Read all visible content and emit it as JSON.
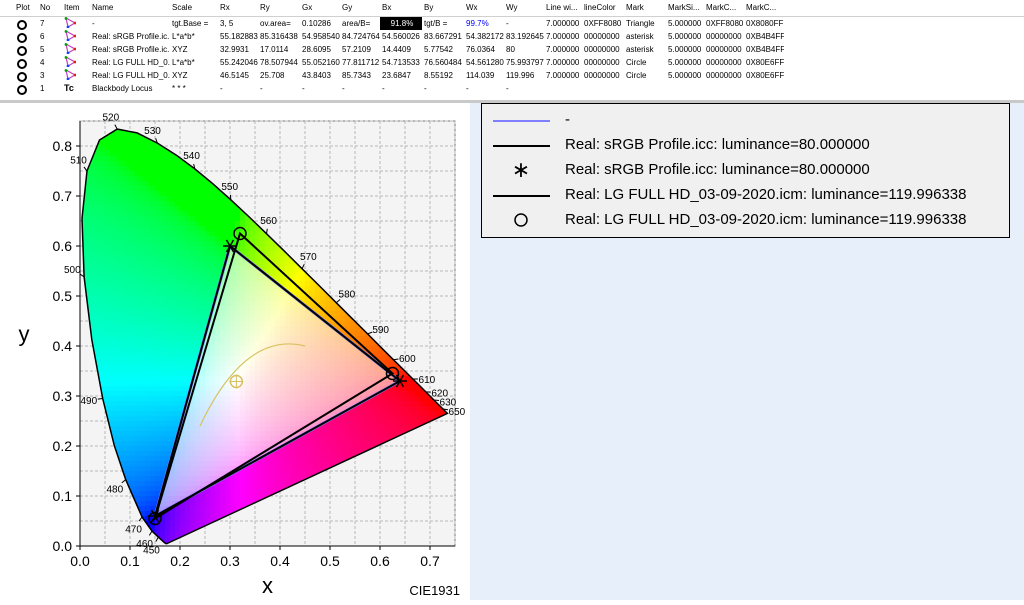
{
  "table": {
    "headers": [
      "Plot",
      "No",
      "Item",
      "Name",
      "Scale",
      "Rx",
      "Ry",
      "Gx",
      "Gy",
      "Bx",
      "By",
      "Wx",
      "Wy",
      "Line wi...",
      "lineColor",
      "Mark",
      "MarkSi...",
      "MarkC...",
      "MarkC..."
    ],
    "rows": [
      {
        "no": "7",
        "icon": "rgb-triangle-icon",
        "name": "-",
        "scale": "tgt.Base =",
        "rx": "3, 5",
        "ry": "ov.area=",
        "gx": "0.10286",
        "gy": "area/B=",
        "bx": "91.8%",
        "by": "tgt/B =",
        "wx": "99.7%",
        "wy": "-",
        "linew": "7.000000",
        "linecolor": "0XFF8080",
        "mark": "Triangle",
        "marksize": "5.000000",
        "markc1": "0XFF8080",
        "markc2": "0X8080FF"
      },
      {
        "no": "6",
        "icon": "rgb-triangle-icon",
        "name": "Real: sRGB Profile.ic...",
        "scale": "L*a*b*",
        "rx": "55.182883",
        "ry": "85.316438",
        "gx": "54.958540",
        "gy": "84.724764",
        "bx": "54.560026",
        "by": "83.667291",
        "wx": "54.382172",
        "wy": "83.192645",
        "linew": "7.000000",
        "linecolor": "00000000",
        "mark": "asterisk",
        "marksize": "5.000000",
        "markc1": "00000000",
        "markc2": "0XB4B4FF"
      },
      {
        "no": "5",
        "icon": "rgb-triangle-icon",
        "name": "Real: sRGB Profile.ic...",
        "scale": "XYZ",
        "rx": "32.9931",
        "ry": "17.0114",
        "gx": "28.6095",
        "gy": "57.2109",
        "bx": "14.4409",
        "by": "5.77542",
        "wx": "76.0364",
        "wy": "80",
        "linew": "7.000000",
        "linecolor": "00000000",
        "mark": "asterisk",
        "marksize": "5.000000",
        "markc1": "00000000",
        "markc2": "0XB4B4FF"
      },
      {
        "no": "4",
        "icon": "rgb-triangle-icon",
        "name": "Real: LG FULL HD_0...",
        "scale": "L*a*b*",
        "rx": "55.242046",
        "ry": "78.507944",
        "gx": "55.052160",
        "gy": "77.811712",
        "bx": "54.713533",
        "by": "76.560484",
        "wx": "54.561280",
        "wy": "75.993797",
        "linew": "7.000000",
        "linecolor": "00000000",
        "mark": "Circle",
        "marksize": "5.000000",
        "markc1": "00000000",
        "markc2": "0X80E6FF"
      },
      {
        "no": "3",
        "icon": "rgb-triangle-icon",
        "name": "Real: LG FULL HD_0...",
        "scale": "XYZ",
        "rx": "46.5145",
        "ry": "25.708",
        "gx": "43.8403",
        "gy": "85.7343",
        "bx": "23.6847",
        "by": "8.55192",
        "wx": "114.039",
        "wy": "119.996",
        "linew": "7.000000",
        "linecolor": "00000000",
        "mark": "Circle",
        "marksize": "5.000000",
        "markc1": "00000000",
        "markc2": "0X80E6FF"
      },
      {
        "no": "1",
        "icon": "tc-icon",
        "name": "Blackbody Locus",
        "scale": "* * *",
        "rx": "-",
        "ry": "-",
        "gx": "-",
        "gy": "-",
        "bx": "-",
        "by": "-",
        "wx": "-",
        "wy": "-",
        "linew": "",
        "linecolor": "",
        "mark": "",
        "marksize": "",
        "markc1": "",
        "markc2": ""
      }
    ]
  },
  "legend": {
    "entries": [
      {
        "text": "-"
      },
      {
        "text": "Real: sRGB Profile.icc: luminance=80.000000"
      },
      {
        "text": "Real: sRGB Profile.icc: luminance=80.000000"
      },
      {
        "text": "Real: LG FULL HD_03-09-2020.icm: luminance=119.996338"
      },
      {
        "text": "Real: LG FULL HD_03-09-2020.icm: luminance=119.996338"
      }
    ],
    "colors": [
      "#8080ff",
      "#000000",
      "#000000",
      "#000000",
      "#000000"
    ],
    "markers": [
      "",
      "",
      "asterisk",
      "",
      "circle"
    ]
  },
  "chart_data": {
    "type": "scatter",
    "title": "",
    "xlabel": "x",
    "ylabel": "y",
    "caption": "CIE1931",
    "xlim": [
      0,
      0.75
    ],
    "ylim": [
      0,
      0.85
    ],
    "x_ticks": [
      "0.0",
      "0.1",
      "0.2",
      "0.3",
      "0.4",
      "0.5",
      "0.6",
      "0.7"
    ],
    "y_ticks": [
      "0.0",
      "0.1",
      "0.2",
      "0.3",
      "0.4",
      "0.5",
      "0.6",
      "0.7",
      "0.8"
    ],
    "grid": true,
    "wavelength_labels": [
      {
        "label": "520",
        "x": 0.0743,
        "y": 0.8338
      },
      {
        "label": "530",
        "x": 0.1547,
        "y": 0.8059
      },
      {
        "label": "540",
        "x": 0.2296,
        "y": 0.7543
      },
      {
        "label": "550",
        "x": 0.3016,
        "y": 0.6923
      },
      {
        "label": "560",
        "x": 0.3731,
        "y": 0.6245
      },
      {
        "label": "570",
        "x": 0.4441,
        "y": 0.5547
      },
      {
        "label": "580",
        "x": 0.5125,
        "y": 0.4866
      },
      {
        "label": "590",
        "x": 0.5752,
        "y": 0.4242
      },
      {
        "label": "600",
        "x": 0.627,
        "y": 0.3725
      },
      {
        "label": "610",
        "x": 0.6658,
        "y": 0.334
      },
      {
        "label": "620",
        "x": 0.6915,
        "y": 0.3083
      },
      {
        "label": "630",
        "x": 0.7079,
        "y": 0.292
      },
      {
        "label": "650",
        "x": 0.726,
        "y": 0.274
      },
      {
        "label": "510",
        "x": 0.0139,
        "y": 0.7502
      },
      {
        "label": "500",
        "x": 0.0082,
        "y": 0.5384
      },
      {
        "label": "490",
        "x": 0.0454,
        "y": 0.295
      },
      {
        "label": "480",
        "x": 0.0913,
        "y": 0.1327
      },
      {
        "label": "470",
        "x": 0.1241,
        "y": 0.0578
      },
      {
        "label": "460",
        "x": 0.144,
        "y": 0.0297
      },
      {
        "label": "450",
        "x": 0.1566,
        "y": 0.0177
      }
    ],
    "series": [
      {
        "name": "-",
        "color": "#8080ff",
        "points": [
          [
            0.64,
            0.33
          ],
          [
            0.3,
            0.6
          ],
          [
            0.15,
            0.06
          ]
        ]
      },
      {
        "name": "Real: sRGB Profile.icc: luminance=80.000000",
        "color": "#000000",
        "marker": "asterisk",
        "points": [
          [
            0.64,
            0.33
          ],
          [
            0.3,
            0.6
          ],
          [
            0.15,
            0.06
          ]
        ]
      },
      {
        "name": "Real: LG FULL HD_03-09-2020.icm: luminance=119.996338",
        "color": "#000000",
        "marker": "circle",
        "points": [
          [
            0.625,
            0.345
          ],
          [
            0.32,
            0.625
          ],
          [
            0.15,
            0.055
          ]
        ]
      }
    ],
    "white_point": {
      "x": 0.3127,
      "y": 0.329
    }
  }
}
